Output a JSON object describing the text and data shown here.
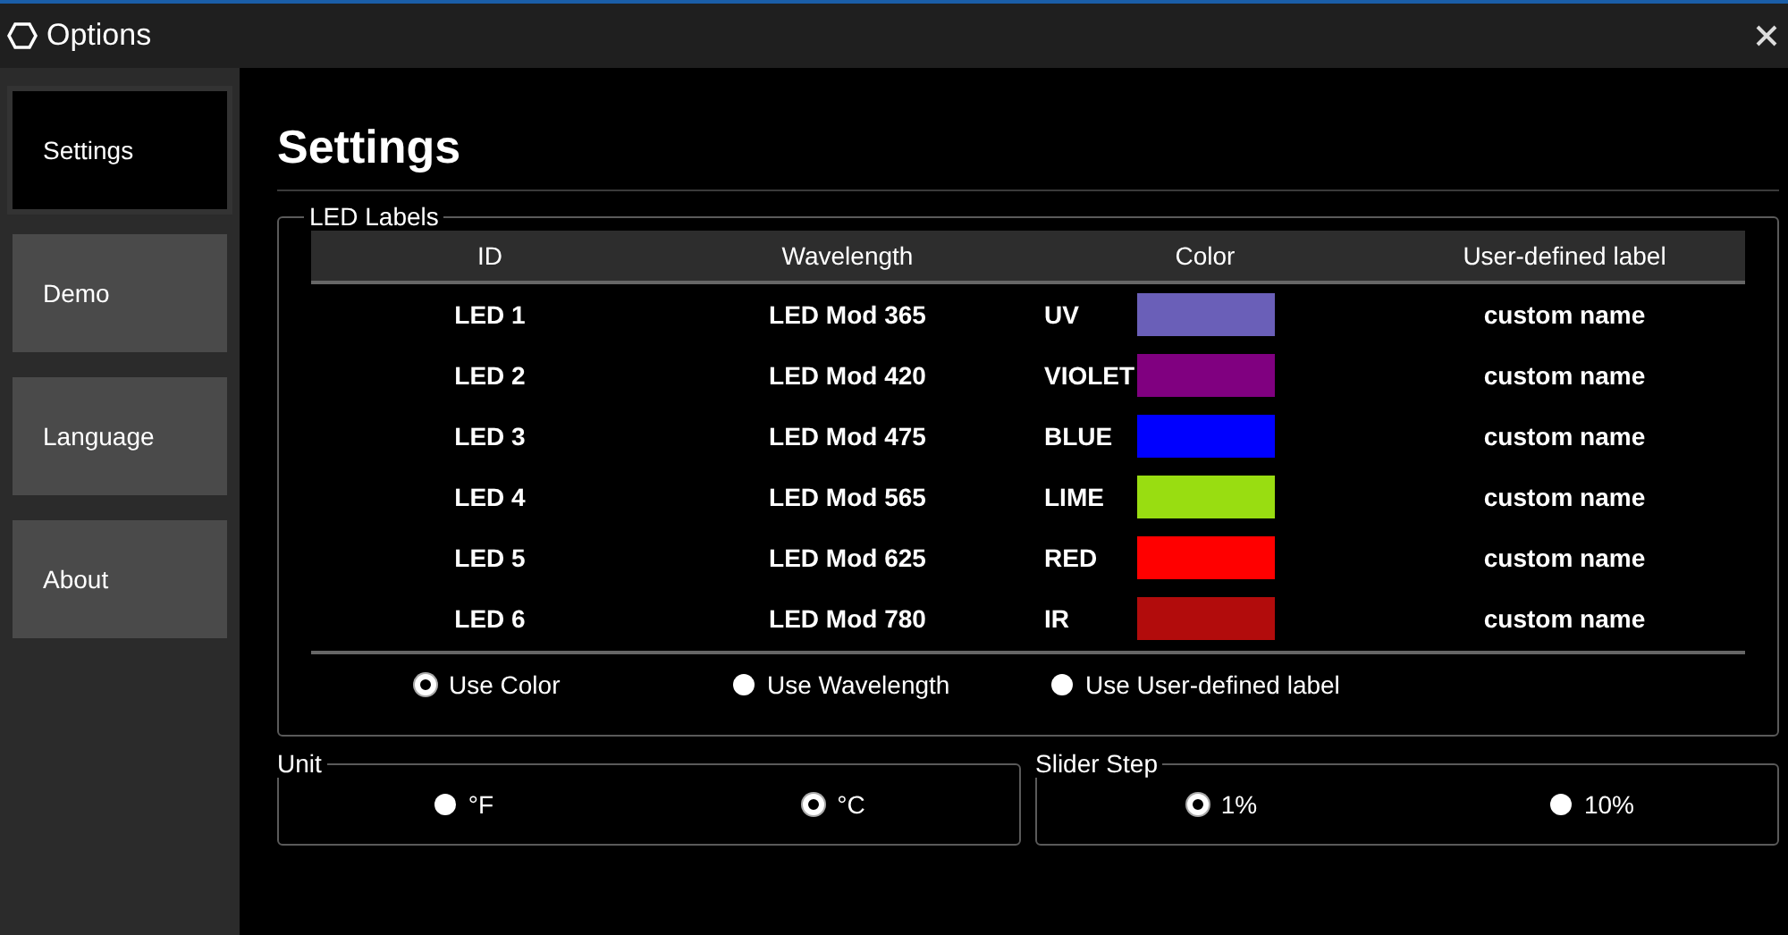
{
  "window": {
    "title": "Options"
  },
  "sidebar": {
    "items": [
      {
        "label": "Settings",
        "selected": true
      },
      {
        "label": "Demo",
        "selected": false
      },
      {
        "label": "Language",
        "selected": false
      },
      {
        "label": "About",
        "selected": false
      }
    ]
  },
  "heading": "Settings",
  "led_labels": {
    "title": "LED Labels",
    "columns": [
      "ID",
      "Wavelength",
      "Color",
      "User-defined label"
    ],
    "rows": [
      {
        "id": "LED 1",
        "wavelength": "LED Mod 365",
        "color_name": "UV",
        "color": "#6a5fb8",
        "label": "custom name"
      },
      {
        "id": "LED 2",
        "wavelength": "LED Mod 420",
        "color_name": "VIOLET",
        "color": "#800080",
        "label": "custom name"
      },
      {
        "id": "LED 3",
        "wavelength": "LED Mod 475",
        "color_name": "BLUE",
        "color": "#0000ff",
        "label": "custom name"
      },
      {
        "id": "LED 4",
        "wavelength": "LED Mod 565",
        "color_name": "LIME",
        "color": "#99dd11",
        "label": "custom name"
      },
      {
        "id": "LED 5",
        "wavelength": "LED Mod 625",
        "color_name": "RED",
        "color": "#ff0000",
        "label": "custom name"
      },
      {
        "id": "LED 6",
        "wavelength": "LED Mod 780",
        "color_name": "IR",
        "color": "#b20c0c",
        "label": "custom name"
      }
    ],
    "options": [
      {
        "label": "Use Color",
        "selected": true
      },
      {
        "label": "Use Wavelength",
        "selected": false
      },
      {
        "label": "Use User-defined label",
        "selected": false
      }
    ]
  },
  "unit": {
    "title": "Unit",
    "options": [
      {
        "label": "°F",
        "selected": false
      },
      {
        "label": "°C",
        "selected": true
      }
    ]
  },
  "slider_step": {
    "title": "Slider Step",
    "options": [
      {
        "label": "1%",
        "selected": true
      },
      {
        "label": "10%",
        "selected": false
      }
    ]
  }
}
